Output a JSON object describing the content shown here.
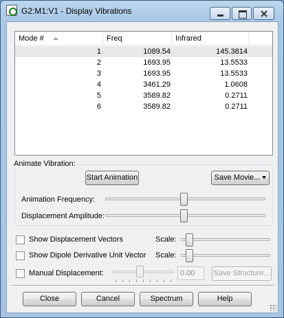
{
  "window": {
    "title": "G2:M1:V1 - Display Vibrations"
  },
  "table": {
    "columns": [
      "Mode #",
      "Freq",
      "Infrared"
    ],
    "rows": [
      {
        "mode": "1",
        "freq": "1089.54",
        "ir": "145.3814"
      },
      {
        "mode": "2",
        "freq": "1693.95",
        "ir": "13.5533"
      },
      {
        "mode": "3",
        "freq": "1693.95",
        "ir": "13.5533"
      },
      {
        "mode": "4",
        "freq": "3461.29",
        "ir": "1.0608"
      },
      {
        "mode": "5",
        "freq": "3589.82",
        "ir": "0.2711"
      },
      {
        "mode": "6",
        "freq": "3589.82",
        "ir": "0.2711"
      }
    ]
  },
  "animate": {
    "group_label": "Animate Vibration:",
    "start_button": "Start Animation",
    "save_movie_button": "Save Movie...",
    "frequency_label": "Animation Frequency:",
    "amplitude_label": "Displacement Amplitude:"
  },
  "options": {
    "show_displacement_vectors": "Show Displacement Vectors",
    "show_dipole_vector": "Show Dipole Derivative Unit Vector",
    "scale_label": "Scale:",
    "manual_displacement": "Manual Displacement:",
    "manual_value": "0.00",
    "save_structure_button": "Save Structure..."
  },
  "buttons": {
    "close": "Close",
    "cancel": "Cancel",
    "spectrum": "Spectrum",
    "help": "Help"
  },
  "icons": [
    "app-icon",
    "minimize-icon",
    "maximize-icon",
    "close-icon",
    "sort-ascending-icon",
    "dropdown-arrow-icon",
    "resize-grip-icon"
  ]
}
